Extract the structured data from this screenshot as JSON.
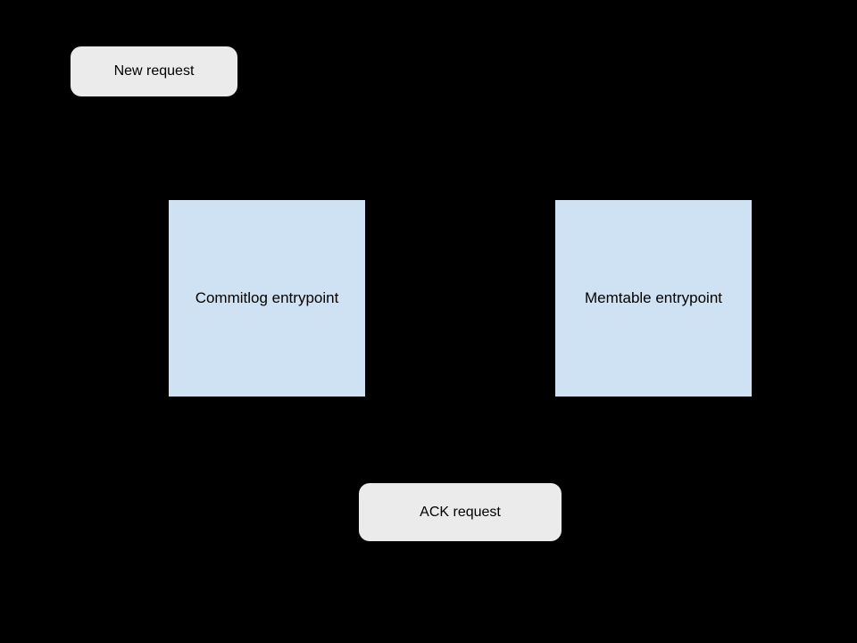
{
  "diagram": {
    "nodes": {
      "newRequest": {
        "label": "New request",
        "type": "rounded",
        "color": "#ebebeb"
      },
      "commitlog": {
        "label": "Commitlog entrypoint",
        "type": "rect",
        "color": "#cfe2f3"
      },
      "memtable": {
        "label": "Memtable entrypoint",
        "type": "rect",
        "color": "#cfe2f3"
      },
      "ackRequest": {
        "label": "ACK request",
        "type": "rounded",
        "color": "#ebebeb"
      }
    }
  }
}
